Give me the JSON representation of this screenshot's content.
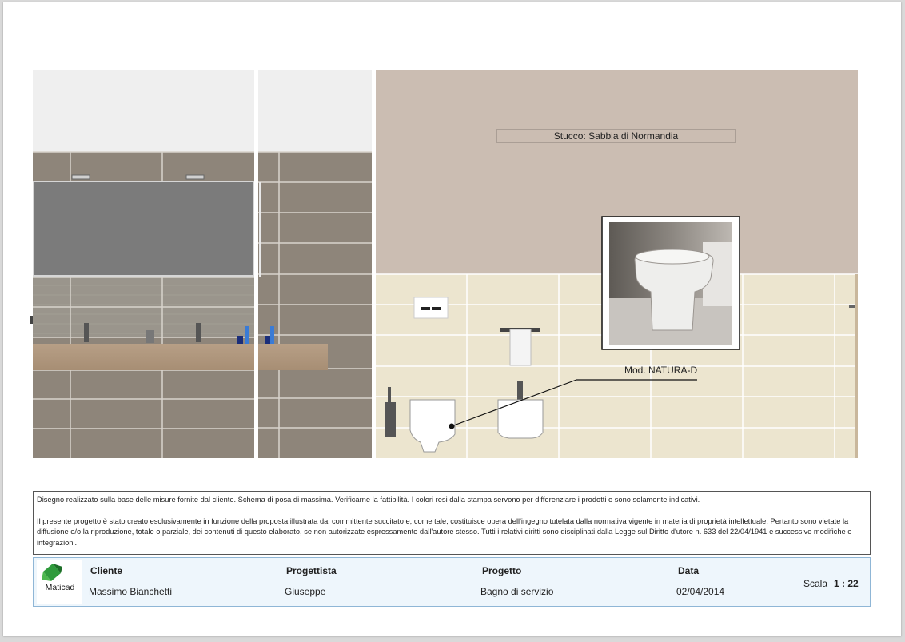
{
  "drawing": {
    "wall_label": "Stucco: Sabbia di Normandia",
    "product_label": "Mod. NATURA-D"
  },
  "notes": {
    "line1": "Disegno realizzato sulla base delle misure fornite dal cliente. Schema di posa di massima. Verificarne la fattibilità. I colori resi dalla stampa servono per differenziare i prodotti e sono solamente indicativi.",
    "line2": "Il presente progetto è stato creato esclusivamente in funzione della proposta illustrata dal committente succitato e, come tale, costituisce opera dell'ingegno tutelata dalla normativa vigente in materia di proprietà intellettuale. Pertanto sono vietate la diffusione e/o la riproduzione, totale o parziale, dei contenuti di questo elaborato, se non autorizzate espressamente dall'autore stesso. Tutti i relativi diritti sono disciplinati dalla Legge sul Diritto d'utore n. 633 del 22/04/1941 e successive modifiche e integrazioni."
  },
  "title_block": {
    "logo_text": "Maticad",
    "cliente_label": "Cliente",
    "cliente_value": "Massimo Bianchetti",
    "progettista_label": "Progettista",
    "progettista_value": "Giuseppe",
    "progetto_label": "Progetto",
    "progetto_value": "Bagno di servizio",
    "data_label": "Data",
    "data_value": "02/04/2014",
    "scala_label": "Scala",
    "scala_value": "1 : 22"
  }
}
